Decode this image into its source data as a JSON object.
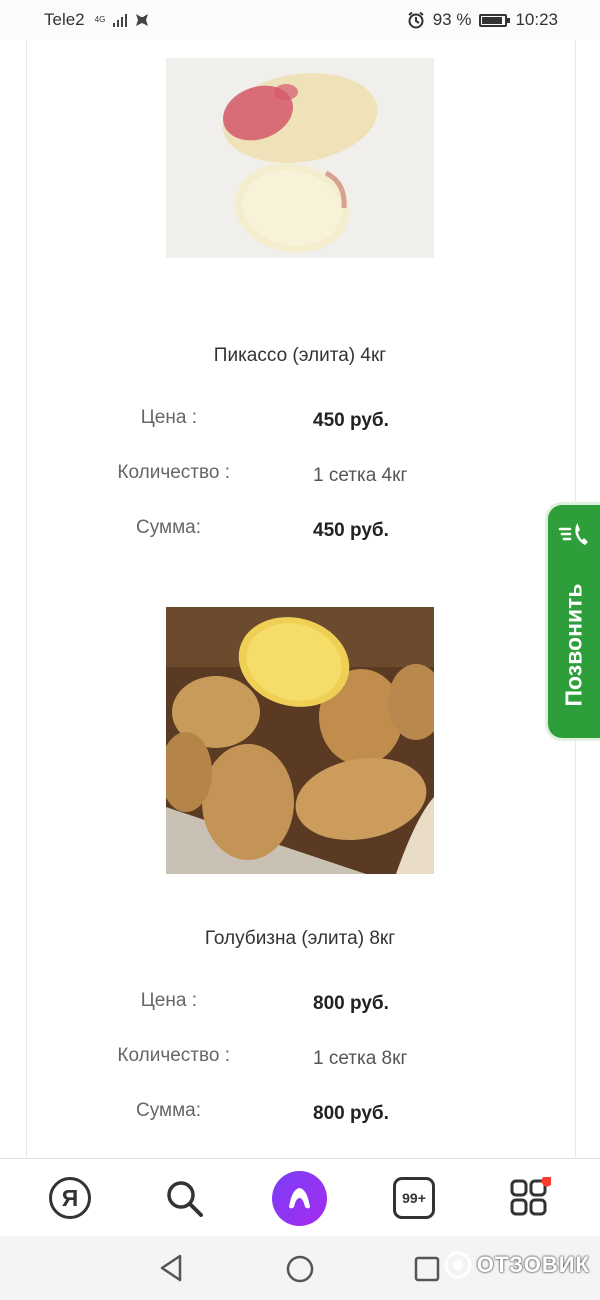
{
  "status_bar": {
    "carrier": "Tele2",
    "network_type": "4G",
    "battery_percent": "93 %",
    "battery_level": 0.93,
    "time": "10:23"
  },
  "products": [
    {
      "title": "Пикассо (элита) 4кг",
      "price_label": "Цена :",
      "price_value": "450 руб.",
      "quantity_label": "Количество :",
      "quantity_value": "1  сетка 4кг",
      "sum_label": "Сумма:",
      "sum_value": "450 руб."
    },
    {
      "title": "Голубизна (элита) 8кг",
      "price_label": "Цена :",
      "price_value": "800 руб.",
      "quantity_label": "Количество :",
      "quantity_value": "1  сетка 8кг",
      "sum_label": "Сумма:",
      "sum_value": "800 руб."
    }
  ],
  "call_widget": {
    "label": "Позвонить"
  },
  "app_bar": {
    "yandex_label": "Я",
    "tabs_count": "99+"
  },
  "watermark": "ОТЗОВИК",
  "colors": {
    "call_green": "#2e9e3a",
    "alice_purple": "#8a35f3",
    "notification_red": "#ff3b30"
  }
}
